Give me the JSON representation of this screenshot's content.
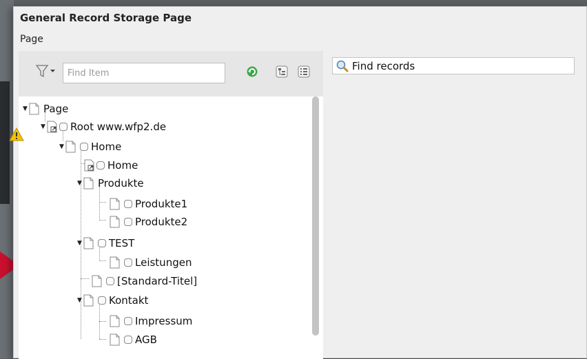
{
  "window": {
    "title": "General Record Storage Page",
    "subtitle": "Page"
  },
  "toolbar": {
    "filter_icon": "filter-icon",
    "find_placeholder": "Find Item",
    "refresh_icon": "refresh-icon",
    "collapse_icon": "collapse-all-icon",
    "list_icon": "list-view-icon"
  },
  "tree": {
    "nodes": [
      {
        "label": "Page",
        "icon": "page-icon"
      },
      {
        "label": "Root www.wfp2.de",
        "icon": "page-shortcut-icon"
      },
      {
        "label": "Home",
        "icon": "page-icon"
      },
      {
        "label": "Home",
        "icon": "page-shortcut-icon"
      },
      {
        "label": "Produkte",
        "icon": "page-icon"
      },
      {
        "label": "Produkte1",
        "icon": "page-icon"
      },
      {
        "label": "Produkte2",
        "icon": "page-icon"
      },
      {
        "label": "TEST",
        "icon": "page-icon"
      },
      {
        "label": "Leistungen",
        "icon": "page-icon"
      },
      {
        "label": "[Standard-Titel]",
        "icon": "page-icon"
      },
      {
        "label": "Kontakt",
        "icon": "page-icon"
      },
      {
        "label": "Impressum",
        "icon": "page-icon"
      },
      {
        "label": "AGB",
        "icon": "page-icon"
      }
    ]
  },
  "records": {
    "button_label": "Find records",
    "icon": "magnifier-icon"
  },
  "colors": {
    "warning": "#f2c200",
    "refresh": "#3aa84a",
    "arrow": "#c8102e"
  }
}
